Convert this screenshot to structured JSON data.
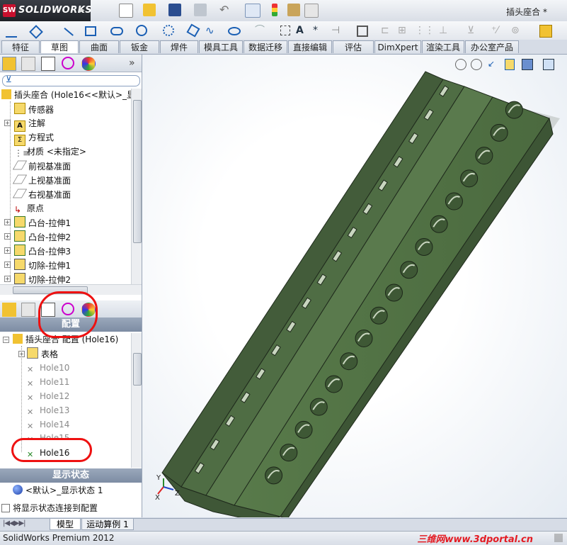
{
  "app": {
    "logo_text": "SOLIDWORKS",
    "logo_badge": "SW",
    "document_title": "插头座合 *"
  },
  "tabs": [
    "特征",
    "草图",
    "曲面",
    "钣金",
    "焊件",
    "模具工具",
    "数据迁移",
    "直接编辑",
    "评估",
    "DimXpert",
    "渲染工具",
    "办公室产品"
  ],
  "feature_tree": {
    "root": "插头座合 (Hole16<<默认>_显",
    "items": [
      "传感器",
      "注解",
      "方程式",
      "材质 <未指定>",
      "前视基准面",
      "上视基准面",
      "右视基准面",
      "原点",
      "凸台-拉伸1",
      "凸台-拉伸2",
      "凸台-拉伸3",
      "切除-拉伸1",
      "切除-拉伸2"
    ]
  },
  "config_panel": {
    "header": "配置",
    "root": "插头座合 配置 (Hole16)",
    "table": "表格",
    "configs": [
      "Hole10",
      "Hole11",
      "Hole12",
      "Hole13",
      "Hole14",
      "Hole15",
      "Hole16"
    ]
  },
  "display_state": {
    "header": "显示状态",
    "item": "<默认>_显示状态 1",
    "checkbox_label": "将显示状态连接到配置"
  },
  "bottom_tabs": [
    "模型",
    "运动算例 1"
  ],
  "status": {
    "text": "SolidWorks Premium 2012",
    "watermark": "三维网www.3dportal.cn"
  },
  "triad": {
    "x": "X",
    "y": "Y",
    "z": "Z"
  },
  "colors": {
    "part": "#4e6b43",
    "part_dark": "#3a5032",
    "part_light": "#62824f",
    "annotation": "#ee1111"
  }
}
